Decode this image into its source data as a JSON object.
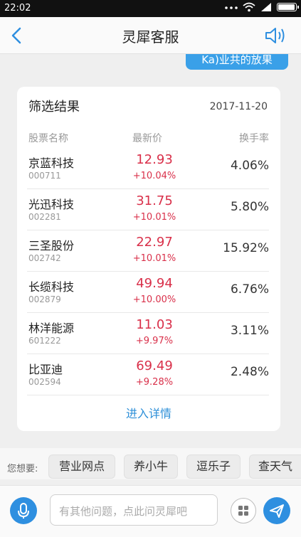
{
  "status_bar": {
    "time": "22:02"
  },
  "header": {
    "title": "灵犀客服"
  },
  "chat": {
    "user_message": "Ka)业共的放果"
  },
  "result_card": {
    "title": "筛选结果",
    "date": "2017-11-20",
    "columns": {
      "name": "股票名称",
      "price": "最新价",
      "turnover": "换手率"
    },
    "rows": [
      {
        "name": "京蓝科技",
        "code": "000711",
        "price": "12.93",
        "change": "+10.04%",
        "turnover": "4.06%"
      },
      {
        "name": "光迅科技",
        "code": "002281",
        "price": "31.75",
        "change": "+10.01%",
        "turnover": "5.80%"
      },
      {
        "name": "三圣股份",
        "code": "002742",
        "price": "22.97",
        "change": "+10.01%",
        "turnover": "15.92%"
      },
      {
        "name": "长缆科技",
        "code": "002879",
        "price": "49.94",
        "change": "+10.00%",
        "turnover": "6.76%"
      },
      {
        "name": "林洋能源",
        "code": "601222",
        "price": "11.03",
        "change": "+9.97%",
        "turnover": "3.11%"
      },
      {
        "name": "比亚迪",
        "code": "002594",
        "price": "69.49",
        "change": "+9.28%",
        "turnover": "2.48%"
      }
    ],
    "details_link": "进入详情"
  },
  "suggestions": {
    "label": "您想要:",
    "chips": [
      "营业网点",
      "养小牛",
      "逗乐子",
      "查天气"
    ]
  },
  "input_bar": {
    "placeholder": "有其他问题，点此问灵犀吧"
  },
  "colors": {
    "accent": "#2e8fe0",
    "price_up": "#d9304a"
  }
}
